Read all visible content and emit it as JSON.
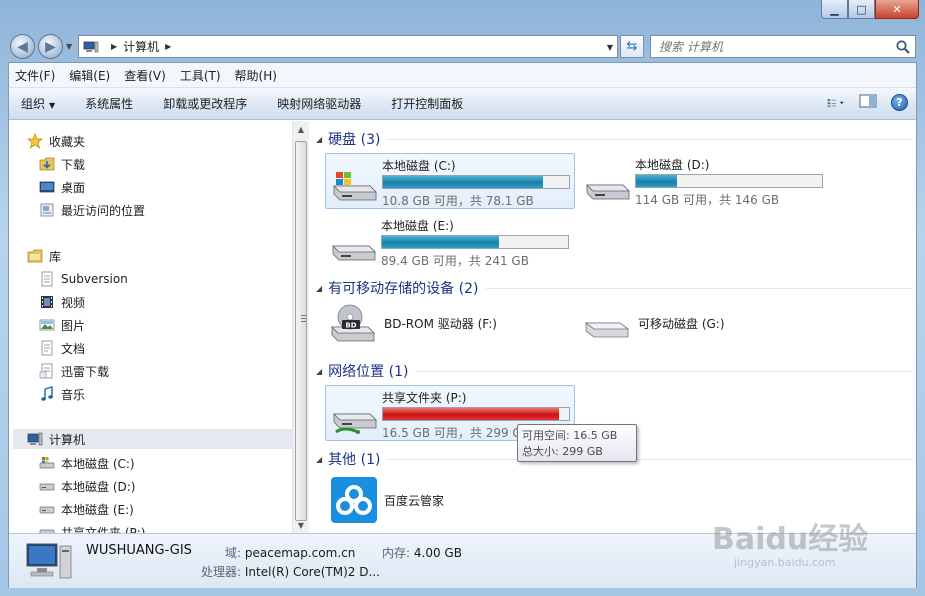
{
  "window": {
    "controls": {
      "minimize": "▁",
      "maximize": "□",
      "close": "✕"
    }
  },
  "address_bar": {
    "location": "计算机",
    "search_placeholder": "搜索 计算机"
  },
  "menu": [
    "文件(F)",
    "编辑(E)",
    "查看(V)",
    "工具(T)",
    "帮助(H)"
  ],
  "toolbar": {
    "organize": "组织",
    "system_properties": "系统属性",
    "uninstall": "卸载或更改程序",
    "map_drive": "映射网络驱动器",
    "control_panel": "打开控制面板",
    "help": "?"
  },
  "sidebar": {
    "favorites": {
      "label": "收藏夹",
      "items": [
        "下载",
        "桌面",
        "最近访问的位置"
      ]
    },
    "libraries": {
      "label": "库",
      "items": [
        "Subversion",
        "视频",
        "图片",
        "文档",
        "迅雷下载",
        "音乐"
      ]
    },
    "computer": {
      "label": "计算机",
      "items": [
        "本地磁盘 (C:)",
        "本地磁盘 (D:)",
        "本地磁盘 (E:)",
        "共享文件夹 (P:)"
      ]
    }
  },
  "groups": {
    "hard_disks": {
      "label": "硬盘 (3)",
      "drives": [
        {
          "name": "本地磁盘 (C:)",
          "info": "10.8 GB 可用，共 78.1 GB",
          "used_fraction": 0.862
        },
        {
          "name": "本地磁盘 (D:)",
          "info": "114 GB 可用，共 146 GB",
          "used_fraction": 0.219
        },
        {
          "name": "本地磁盘 (E:)",
          "info": "89.4 GB 可用，共 241 GB",
          "used_fraction": 0.629
        }
      ]
    },
    "removable": {
      "label": "有可移动存储的设备 (2)",
      "devices": [
        "BD-ROM 驱动器 (F:)",
        "可移动磁盘 (G:)"
      ],
      "bd_badge": "BD"
    },
    "network": {
      "label": "网络位置 (1)",
      "drive": {
        "name": "共享文件夹 (P:)",
        "info": "16.5 GB 可用，共 299 GB",
        "used_fraction": 0.945
      }
    },
    "other": {
      "label": "其他 (1)",
      "items": [
        "百度云管家"
      ]
    }
  },
  "tooltip": {
    "free": "可用空间: 16.5 GB",
    "total": "总大小: 299 GB"
  },
  "details": {
    "computer_name": "WUSHUANG-GIS",
    "domain_label": "域:",
    "domain": "peacemap.com.cn",
    "memory_label": "内存:",
    "memory": "4.00 GB",
    "processor_label": "处理器:",
    "processor": "Intel(R) Core(TM)2 D..."
  },
  "watermark": {
    "brand": "Baidu经验",
    "url": "jingyan.baidu.com"
  }
}
